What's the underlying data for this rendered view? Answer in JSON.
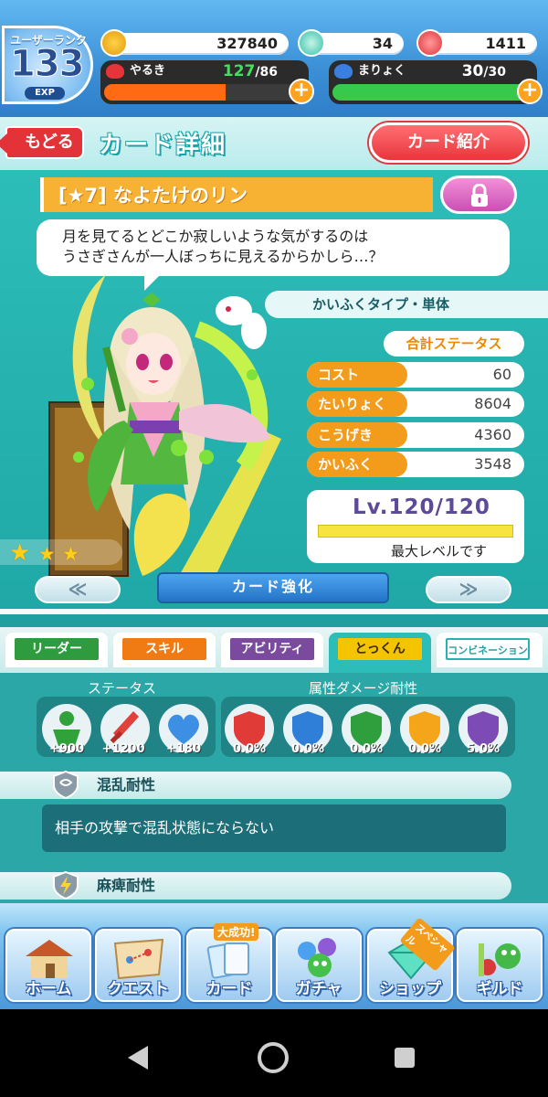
{
  "header": {
    "user_rank_label": "ユーザーランク",
    "user_rank": "133",
    "exp_label": "EXP",
    "coins": "327840",
    "gems": "34",
    "tickets": "1411",
    "stamina": {
      "label": "やるき",
      "current": "127",
      "max": "/86",
      "fill": 0.62,
      "color": "#ff6a13"
    },
    "magic": {
      "label": "まりょく",
      "current": "30",
      "max": "/30",
      "fill": 1.0,
      "color": "#37c94c"
    },
    "plus_label": "+"
  },
  "titlebar": {
    "back_label": "もどる",
    "title": "カード詳細",
    "intro_label": "カード紹介"
  },
  "card": {
    "name": "[★7]  なよたけのリン",
    "quote_line1": "月を見てるとどこか寂しいような気がするのは",
    "quote_line2": "うさぎさんが一人ぼっちに見えるからかしら…？",
    "type": "かいふくタイプ・単体",
    "total_status_label": "合計ステータス",
    "stats": [
      {
        "label": "コスト",
        "value": "60"
      },
      {
        "label": "たいりょく",
        "value": "8604"
      },
      {
        "label": "こうげき",
        "value": "4360"
      },
      {
        "label": "かいふく",
        "value": "3548"
      }
    ],
    "level_text": "Lv.120/120",
    "level_fill": 1.0,
    "max_level_label": "最大レベルです",
    "stars_filled": 3,
    "upgrade_label": "カード強化",
    "prev_label": "≪",
    "next_label": "≫"
  },
  "tabs": [
    {
      "label": "リーダー",
      "color": "#2e9b3e",
      "active": false
    },
    {
      "label": "スキル",
      "color": "#f07a13",
      "active": false
    },
    {
      "label": "アビリティ",
      "color": "#7a4a9e",
      "active": false
    },
    {
      "label": "とっくん",
      "color": "#f5c400",
      "active": true
    },
    {
      "label": "コンビネーション",
      "color": "#2bb0b2",
      "active": false
    }
  ],
  "tokkun": {
    "status_title": "ステータス",
    "status_values": [
      "+900",
      "+1200",
      "+180"
    ],
    "resist_title": "属性ダメージ耐性",
    "resist_values": [
      "0.0%",
      "0.0%",
      "0.0%",
      "0.0%",
      "5.0%"
    ],
    "resist_colors": [
      "#e03b36",
      "#2f7fd8",
      "#2f9e3c",
      "#f5a51a",
      "#7d4bb5"
    ],
    "skill1_title": "混乱耐性",
    "skill1_desc": "相手の攻撃で混乱状態にならない",
    "skill2_title": "麻痺耐性"
  },
  "bottom_nav": [
    {
      "label": "ホーム"
    },
    {
      "label": "クエスト"
    },
    {
      "label": "カード",
      "badge": "大成功!"
    },
    {
      "label": "ガチャ"
    },
    {
      "label": "ショップ",
      "badge": "スペシャル"
    },
    {
      "label": "ギルド"
    }
  ]
}
